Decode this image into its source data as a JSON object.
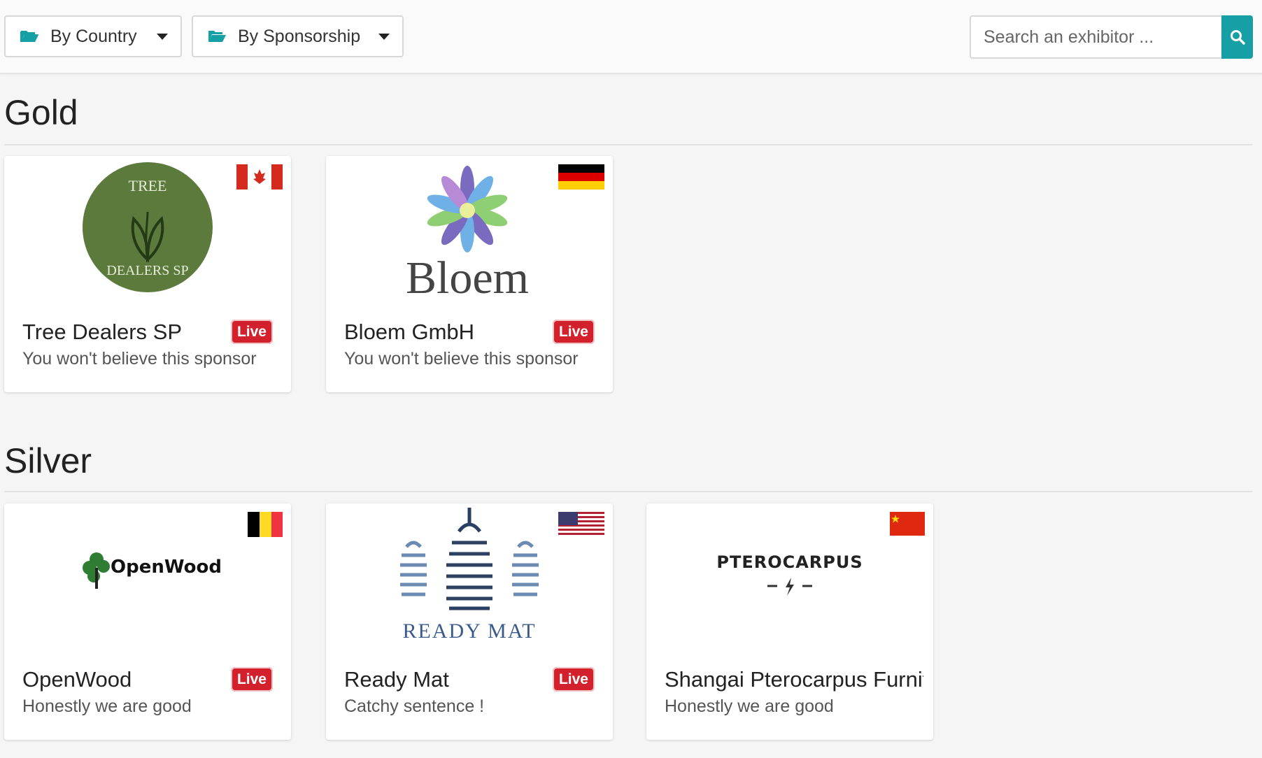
{
  "filters": {
    "country_label": "By Country",
    "sponsorship_label": "By Sponsorship"
  },
  "search": {
    "placeholder": "Search an exhibitor ..."
  },
  "colors": {
    "accent": "#16a0a6",
    "live_badge": "#d3202d"
  },
  "sections": [
    {
      "title": "Gold",
      "exhibitors": [
        {
          "name": "Tree Dealers SP",
          "tagline": "You won't believe this sponsor",
          "badge": "Live",
          "flag": "canada-flag",
          "logo_text_top": "TREE",
          "logo_text_bottom": "DEALERS SP"
        },
        {
          "name": "Bloem GmbH",
          "tagline": "You won't believe this sponsor",
          "badge": "Live",
          "flag": "germany-flag",
          "logo_text": "Bloem"
        }
      ]
    },
    {
      "title": "Silver",
      "exhibitors": [
        {
          "name": "OpenWood",
          "tagline": "Honestly we are good",
          "badge": "Live",
          "flag": "belgium-flag",
          "logo_text": "OpenWood"
        },
        {
          "name": "Ready Mat",
          "tagline": "Catchy sentence !",
          "badge": "Live",
          "flag": "usa-flag",
          "logo_text": "READY MAT"
        },
        {
          "name": "Shangai Pterocarpus Furnit",
          "tagline": "Honestly we are good",
          "badge": "",
          "flag": "china-flag",
          "logo_text": "PTEROCARPUS"
        }
      ]
    }
  ]
}
